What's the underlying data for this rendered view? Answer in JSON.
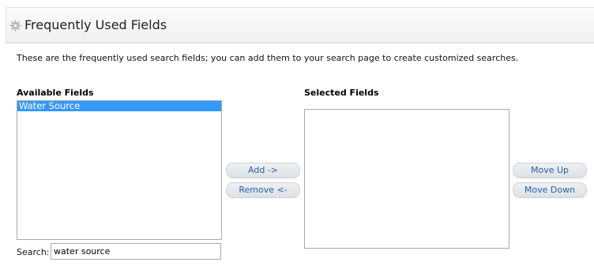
{
  "header": {
    "title": "Frequently Used Fields",
    "icon": "gear-icon"
  },
  "description": "These are the frequently used search fields; you can add them to your search page to create customized searches.",
  "available": {
    "label": "Available Fields",
    "options": [
      {
        "label": "Water Source",
        "selected": true
      }
    ]
  },
  "selected": {
    "label": "Selected Fields",
    "options": []
  },
  "buttons": {
    "add": "Add ->",
    "remove": "Remove <-",
    "move_up": "Move Up",
    "move_down": "Move Down"
  },
  "search": {
    "label": "Search:",
    "value": "water source"
  },
  "colors": {
    "selection": "#3399ff",
    "button_text": "#2a5db0"
  }
}
